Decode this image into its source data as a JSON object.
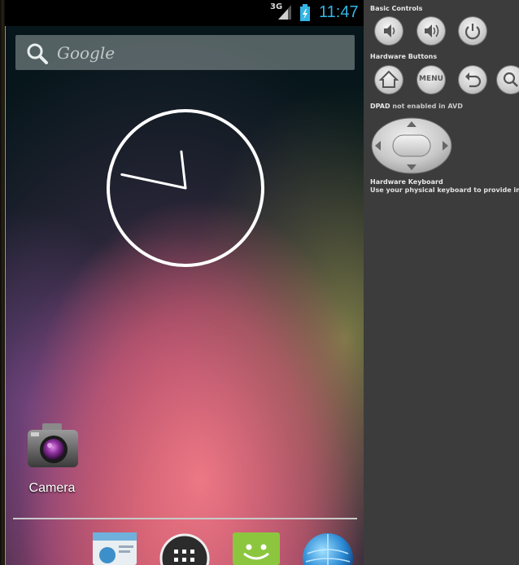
{
  "status_bar": {
    "network_type": "3G",
    "time": "11:47"
  },
  "search": {
    "label": "Google",
    "icon": "search-icon"
  },
  "home": {
    "clock": {
      "hour": 11,
      "minute": 47
    },
    "apps": [
      {
        "label": "Camera",
        "icon": "camera-icon"
      }
    ],
    "dock": [
      "people-icon",
      "all-apps-icon",
      "android-market-icon",
      "browser-icon"
    ]
  },
  "panel": {
    "basic_controls_title": "Basic Controls",
    "hardware_buttons_title": "Hardware Buttons",
    "menu_label": "MENU",
    "dpad_title": "DPAD",
    "dpad_status": "not enabled in AVD",
    "keyboard_title": "Hardware Keyboard",
    "keyboard_desc": "Use your physical keyboard to provide input"
  },
  "colors": {
    "time_accent": "#33b5e5",
    "panel_bg": "#3c3c3c"
  }
}
